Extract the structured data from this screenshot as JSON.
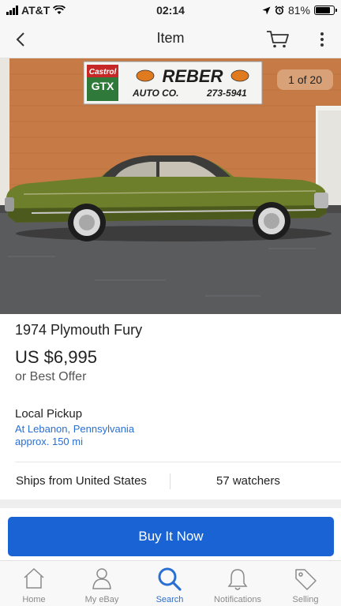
{
  "status_bar": {
    "carrier": "AT&T",
    "time": "02:14",
    "battery": "81%",
    "battery_level": 0.81
  },
  "nav": {
    "title": "Item",
    "back_icon": "chevron-left-icon",
    "cart_icon": "cart-icon",
    "more_icon": "more-vertical-icon"
  },
  "photo": {
    "counter": "1 of 20",
    "sign": {
      "brand": "Castrol",
      "brand_product": "GTX",
      "name": "REBER",
      "line": "AUTO CO.",
      "phone": "273-5941"
    }
  },
  "listing": {
    "title": "1974 Plymouth Fury",
    "price": "US $6,995",
    "offer": "or Best Offer",
    "pickup_label": "Local Pickup",
    "pickup_location": "At Lebanon, Pennsylvania",
    "pickup_distance": "approx. 150 mi",
    "ships_from": "Ships from United States",
    "watchers": "57 watchers",
    "buy_label": "Buy It Now"
  },
  "tabs": [
    {
      "label": "Home",
      "icon": "home-icon",
      "active": false
    },
    {
      "label": "My eBay",
      "icon": "person-icon",
      "active": false
    },
    {
      "label": "Search",
      "icon": "search-icon",
      "active": true
    },
    {
      "label": "Notifications",
      "icon": "bell-icon",
      "active": false
    },
    {
      "label": "Selling",
      "icon": "tag-icon",
      "active": false
    }
  ],
  "colors": {
    "accent": "#1a63d4",
    "link": "#2a6fd2",
    "car_green": "#6e7f2c"
  }
}
